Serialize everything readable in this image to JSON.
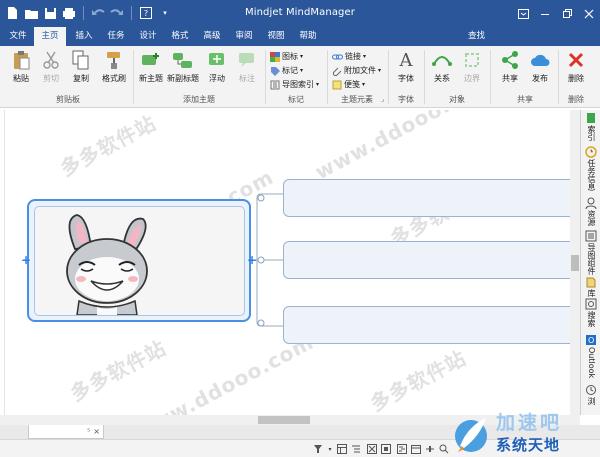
{
  "app": {
    "title": "Mindjet MindManager"
  },
  "colors": {
    "accent": "#2b579a",
    "topic_border": "#9bb3d2",
    "selection": "#4a90e2"
  },
  "quick_access": {
    "icons": [
      "new-icon",
      "open-icon",
      "save-icon",
      "print-icon",
      "undo-icon",
      "redo-icon",
      "help-icon"
    ],
    "help_label": "?"
  },
  "tabs": {
    "file": "文件",
    "home": "主页",
    "insert": "插入",
    "task": "任务",
    "design": "设计",
    "format": "格式",
    "advanced": "高级",
    "review": "审阅",
    "view": "视图",
    "help": "帮助",
    "search": "查找",
    "active": "主页"
  },
  "ribbon": {
    "paste": "粘贴",
    "cut": "剪切",
    "copy": "复制",
    "format_painter": "格式刷",
    "new_topic": "新主题",
    "new_subtopic": "新副标题",
    "floating": "浮动",
    "callout": "标注",
    "icon": "图标",
    "tag": "标记",
    "map_index": "导图索引",
    "link": "链接",
    "attachment": "附加文件",
    "note": "便笺",
    "font": "字体",
    "relation": "关系",
    "boundary": "边界",
    "share": "共享",
    "publish": "发布",
    "delete": "删除",
    "groups": {
      "clipboard": "剪贴板",
      "add_topic": "添加主题",
      "markers": "标记",
      "topic_elements": "主题元素",
      "font": "字体",
      "objects": "对象",
      "share": "共享",
      "delete": "删除"
    }
  },
  "sidepane": {
    "index": "索引",
    "task_info": "任务信息",
    "resources": "资源",
    "map_parts": "导图组件",
    "library": "库",
    "search": "搜索",
    "outlook": "Outlook",
    "more": "浏"
  },
  "watermarks": {
    "cn": "多多软件站",
    "url": "www.ddooo.com"
  },
  "document": {
    "tab_label": "",
    "tab_pin": "⁵",
    "tab_close": "×"
  },
  "logo": {
    "top": "加速吧",
    "bottom": "系统天地"
  }
}
